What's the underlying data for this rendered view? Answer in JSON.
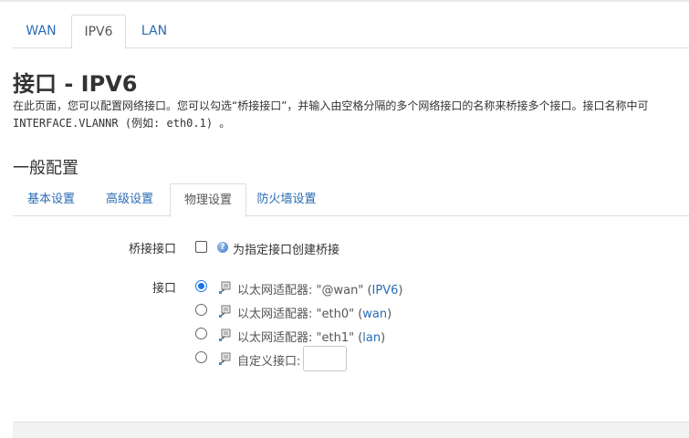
{
  "top_tabs": [
    "WAN",
    "IPV6",
    "LAN"
  ],
  "page": {
    "title": "接口 - IPV6",
    "description": "在此页面，您可以配置网络接口。您可以勾选“桥接接口”，并输入由空格分隔的多个网络接口的名称来桥接多个接口。接口名称中可",
    "description2": "INTERFACE.VLANNR (例如: eth0.1) 。"
  },
  "section": {
    "title": "一般配置"
  },
  "sub_tabs": [
    "基本设置",
    "高级设置",
    "物理设置",
    "防火墙设置"
  ],
  "bridge": {
    "label": "桥接接口",
    "help": "为指定接口创建桥接"
  },
  "iface": {
    "label": "接口",
    "options": [
      {
        "prefix": "以太网适配器: \"@wan\" (",
        "link": "IPV6",
        "suffix": ")"
      },
      {
        "prefix": "以太网适配器: \"eth0\" (",
        "link": "wan",
        "suffix": ")"
      },
      {
        "prefix": "以太网适配器: \"eth1\" (",
        "link": "lan",
        "suffix": ")"
      },
      {
        "prefix": "自定义接口:",
        "link": "",
        "suffix": ""
      }
    ]
  },
  "colors": {
    "link": "#2a6db5",
    "radio_checked": "#1a73e8"
  }
}
